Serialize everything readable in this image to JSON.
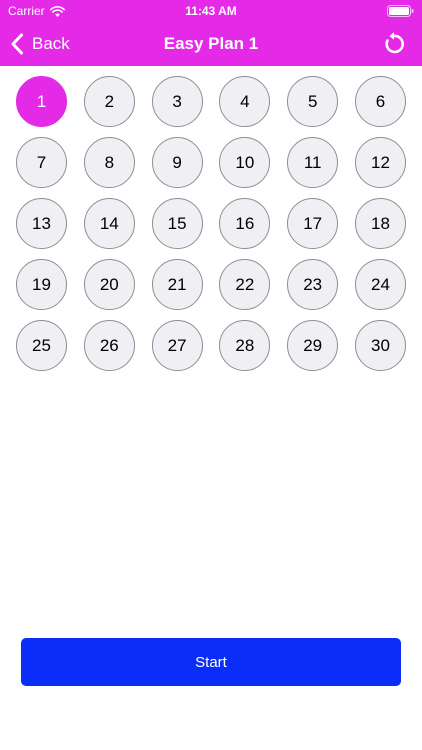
{
  "status_bar": {
    "carrier": "Carrier",
    "time": "11:43 AM",
    "wifi_icon": "wifi-icon",
    "battery_icon": "battery-icon"
  },
  "nav": {
    "back_label": "Back",
    "back_icon": "chevron-left-icon",
    "title": "Easy Plan 1",
    "reset_icon": "refresh-icon"
  },
  "colors": {
    "accent": "#e42ae7",
    "day_fill": "#efeff4",
    "day_border": "#8e8e93",
    "start_button": "#0b2df8"
  },
  "days": {
    "selected": "1",
    "items": [
      "1",
      "2",
      "3",
      "4",
      "5",
      "6",
      "7",
      "8",
      "9",
      "10",
      "11",
      "12",
      "13",
      "14",
      "15",
      "16",
      "17",
      "18",
      "19",
      "20",
      "21",
      "22",
      "23",
      "24",
      "25",
      "26",
      "27",
      "28",
      "29",
      "30"
    ]
  },
  "start_button": {
    "label": "Start"
  }
}
